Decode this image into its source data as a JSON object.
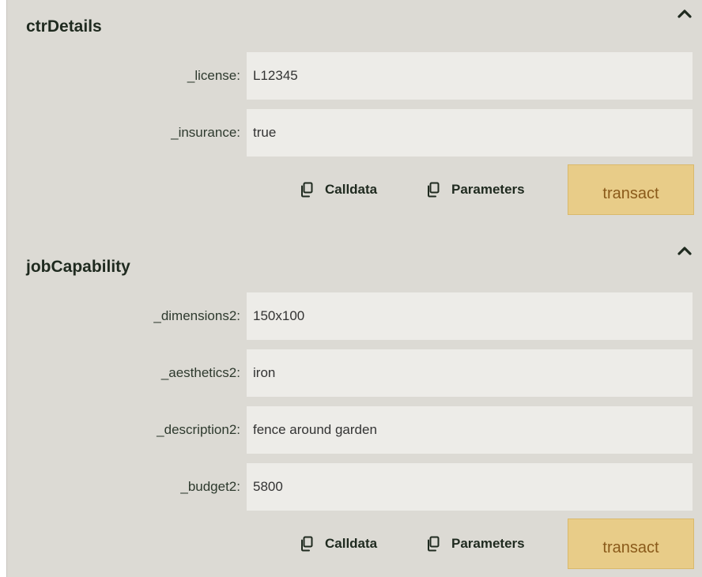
{
  "sections": [
    {
      "title": "ctrDetails",
      "fields": [
        {
          "label": "_license:",
          "value": "L12345"
        },
        {
          "label": "_insurance:",
          "value": "true"
        }
      ],
      "calldata_label": "Calldata",
      "parameters_label": "Parameters",
      "transact_label": "transact"
    },
    {
      "title": "jobCapability",
      "fields": [
        {
          "label": "_dimensions2:",
          "value": "150x100"
        },
        {
          "label": "_aesthetics2:",
          "value": "iron"
        },
        {
          "label": "_description2:",
          "value": "fence around garden"
        },
        {
          "label": "_budget2:",
          "value": "5800"
        }
      ],
      "calldata_label": "Calldata",
      "parameters_label": "Parameters",
      "transact_label": "transact"
    }
  ],
  "icons": {
    "collapse": "chevron-up-icon",
    "copy": "copy-icon"
  },
  "colors": {
    "panel_bg": "#dcdad4",
    "input_bg": "#edece8",
    "transact_bg": "#e8cc88",
    "transact_text": "#8a5a1a"
  }
}
